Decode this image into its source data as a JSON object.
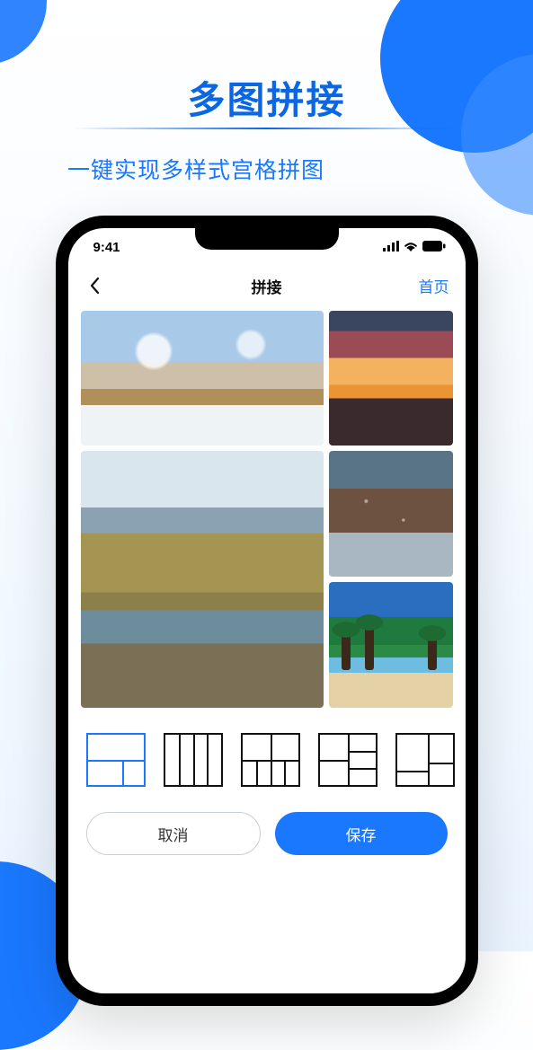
{
  "promo": {
    "title": "多图拼接",
    "subtitle": "一键实现多样式宫格拼图"
  },
  "status": {
    "time": "9:41"
  },
  "nav": {
    "title": "拼接",
    "home": "首页"
  },
  "collage": {
    "slots": [
      {
        "name": "winter-river"
      },
      {
        "name": "sunset-sky"
      },
      {
        "name": "coast-cliff"
      },
      {
        "name": "snow-street"
      },
      {
        "name": "tropical-beach"
      }
    ]
  },
  "templates": [
    {
      "id": "layout-1",
      "selected": true
    },
    {
      "id": "layout-2",
      "selected": false
    },
    {
      "id": "layout-3",
      "selected": false
    },
    {
      "id": "layout-4",
      "selected": false
    },
    {
      "id": "layout-5",
      "selected": false
    }
  ],
  "buttons": {
    "cancel": "取消",
    "save": "保存"
  },
  "colors": {
    "accent": "#1a78ff"
  }
}
